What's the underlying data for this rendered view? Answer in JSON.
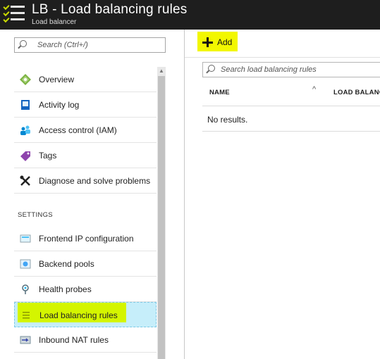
{
  "header": {
    "title": "LB - Load balancing rules",
    "subtitle": "Load balancer",
    "menu_icon": "hamburger-menu-icon",
    "background": "#1e1e1e"
  },
  "left_blade": {
    "search": {
      "placeholder": "Search (Ctrl+/)"
    },
    "items": [
      {
        "label": "Overview",
        "icon": "overview-icon"
      },
      {
        "label": "Activity log",
        "icon": "activity-log-icon"
      },
      {
        "label": "Access control (IAM)",
        "icon": "iam-icon"
      },
      {
        "label": "Tags",
        "icon": "tag-icon"
      },
      {
        "label": "Diagnose and solve problems",
        "icon": "wrench-icon"
      }
    ],
    "settings_label": "SETTINGS",
    "settings_items": [
      {
        "label": "Frontend IP configuration",
        "icon": "frontend-ip-icon"
      },
      {
        "label": "Backend pools",
        "icon": "backend-pool-icon"
      },
      {
        "label": "Health probes",
        "icon": "health-probe-icon"
      },
      {
        "label": "Load balancing rules",
        "icon": "lb-rules-icon",
        "selected": true
      },
      {
        "label": "Inbound NAT rules",
        "icon": "nat-rules-icon"
      }
    ],
    "selected_color": "#c6eefa",
    "highlight_color": "#d4f500"
  },
  "content": {
    "add_label": "Add",
    "search": {
      "placeholder": "Search load balancing rules"
    },
    "columns": [
      "NAME",
      "LOAD BALANC"
    ],
    "empty_message": "No results."
  }
}
